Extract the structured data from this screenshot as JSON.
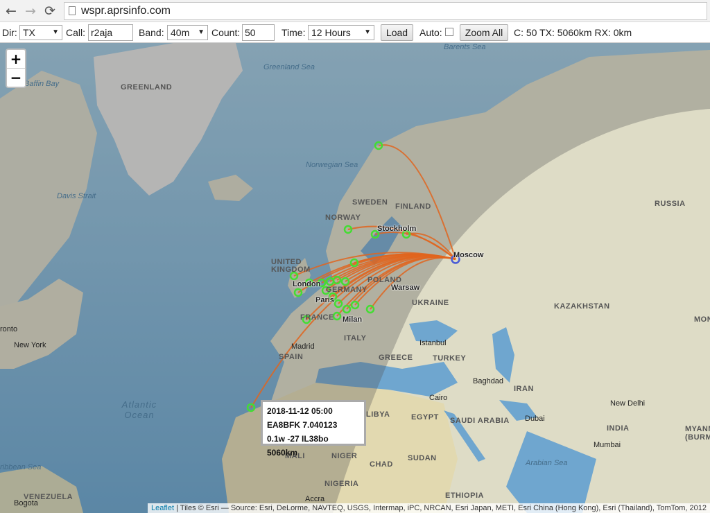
{
  "browser": {
    "url": "wspr.aprsinfo.com",
    "back_icon": "←",
    "forward_icon": "→",
    "reload_icon": "⟳"
  },
  "controls": {
    "dir_label": "Dir:",
    "dir_value": "TX",
    "call_label": "Call:",
    "call_value": "r2aja",
    "band_label": "Band:",
    "band_value": "40m",
    "count_label": "Count:",
    "count_value": "50",
    "time_label": "Time:",
    "time_value": "12 Hours",
    "load_label": "Load",
    "auto_label": "Auto:",
    "auto_checked": false,
    "zoomall_label": "Zoom All",
    "summary": "C: 50 TX: 5060km RX: 0km"
  },
  "map": {
    "zoom_in": "+",
    "zoom_out": "−",
    "tx_station": "Moscow",
    "popup": {
      "line1": "2018-11-12 05:00",
      "line2": "EA8BFK 7.040123",
      "line3": "0.1w -27 IL38bo 5060km"
    },
    "attribution_link": "Leaflet",
    "attribution_text": " | Tiles © Esri — Source: Esri, DeLorme, NAVTEQ, USGS, Intermap, iPC, NRCAN, Esri Japan, METI, Esri China (Hong Kong), Esri (Thailand), TomTom, 2012",
    "colors": {
      "path": "#e0651e",
      "spot": "#44dd33",
      "tx": "#4a5cd6",
      "water": "#7fb2d6",
      "land": "#dfdcc8",
      "night": "#6a6a6a"
    },
    "labels": {
      "countries": [
        "GREENLAND",
        "SWEDEN",
        "FINLAND",
        "NORWAY",
        "RUSSIA",
        "UNITED KINGDOM",
        "POLAND",
        "GERMANY",
        "UKRAINE",
        "FRANCE",
        "ITALY",
        "SPAIN",
        "GREECE",
        "TURKEY",
        "KAZAKHSTAN",
        "IRAN",
        "LIBYA",
        "EGYPT",
        "SAUDI ARABIA",
        "MALI",
        "NIGER",
        "CHAD",
        "SUDAN",
        "NIGERIA",
        "ETHIOPIA",
        "INDIA",
        "MYANMAR (BURMA)",
        "VENEZUELA",
        "MON"
      ],
      "seas": [
        "Barents Sea",
        "Greenland Sea",
        "Baffin Bay",
        "Norwegian Sea",
        "Davis Strait",
        "Arabian Sea",
        "ribbean Sea"
      ],
      "ocean": "Atlantic Ocean",
      "cities": [
        "Stockholm",
        "London",
        "Paris",
        "Milan",
        "Warsaw",
        "Madrid",
        "Istanbul",
        "Baghdad",
        "Cairo",
        "Dubai",
        "New Delhi",
        "Mumbai",
        "New York",
        "ronto",
        "Bogota",
        "Accra"
      ]
    }
  }
}
